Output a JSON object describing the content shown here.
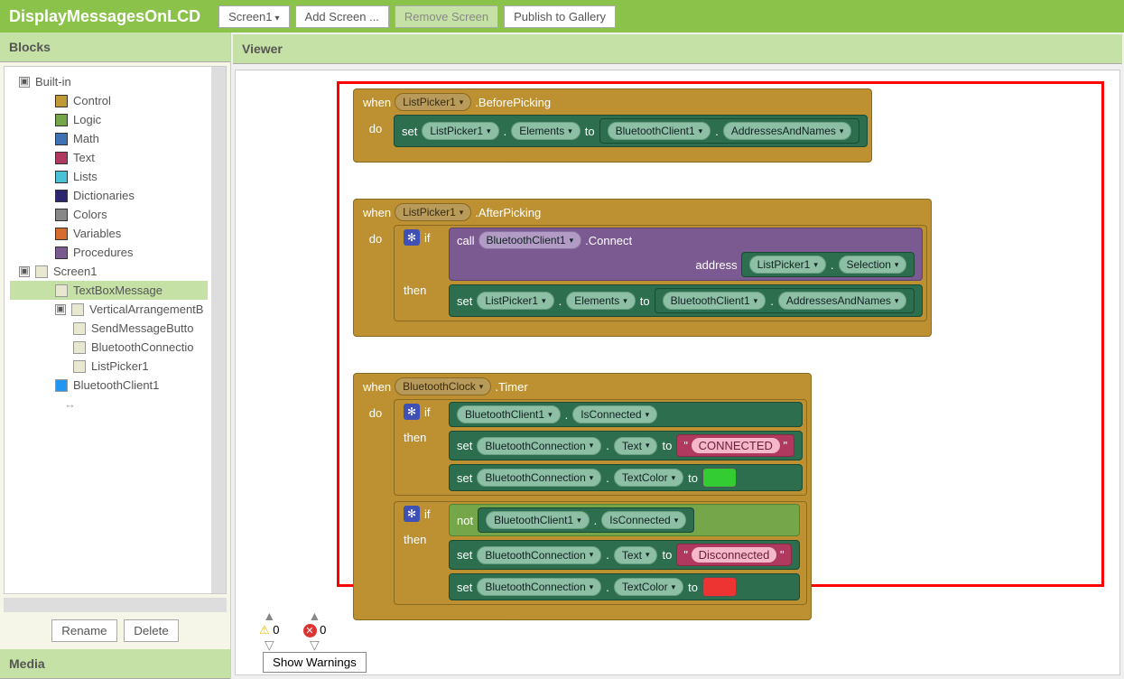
{
  "app_title": "DisplayMessagesOnLCD",
  "toolbar": {
    "screen_select": "Screen1",
    "add_screen": "Add Screen ...",
    "remove_screen": "Remove Screen",
    "publish": "Publish to Gallery"
  },
  "sidebar": {
    "panel_blocks": "Blocks",
    "panel_media": "Media",
    "builtin": "Built-in",
    "items": [
      "Control",
      "Logic",
      "Math",
      "Text",
      "Lists",
      "Dictionaries",
      "Colors",
      "Variables",
      "Procedures"
    ],
    "screen": "Screen1",
    "components": [
      "TextBoxMessage",
      "VerticalArrangementB",
      "SendMessageButto",
      "BluetoothConnectio",
      "ListPicker1",
      "BluetoothClient1"
    ],
    "rename": "Rename",
    "delete": "Delete"
  },
  "viewer_title": "Viewer",
  "b": {
    "when": "when",
    "do": "do",
    "if": "if",
    "then": "then",
    "set": "set",
    "to": "to",
    "call": "call",
    "not": "not",
    "address": "address",
    "lp": "ListPicker1",
    "bc": "BluetoothClient1",
    "btconn": "BluetoothConnection",
    "btclock": "BluetoothClock",
    "before": ".BeforePicking",
    "after": ".AfterPicking",
    "timer": ".Timer",
    "elements": "Elements",
    "addr_names": "AddressesAndNames",
    "connect": ".Connect",
    "selection": "Selection",
    "isconn": "IsConnected",
    "text": "Text",
    "textcolor": "TextColor",
    "str_conn": "CONNECTED",
    "str_disc": "Disconnected",
    "quote": "\""
  },
  "warnings": {
    "yellow": "0",
    "red": "0",
    "show": "Show Warnings"
  }
}
